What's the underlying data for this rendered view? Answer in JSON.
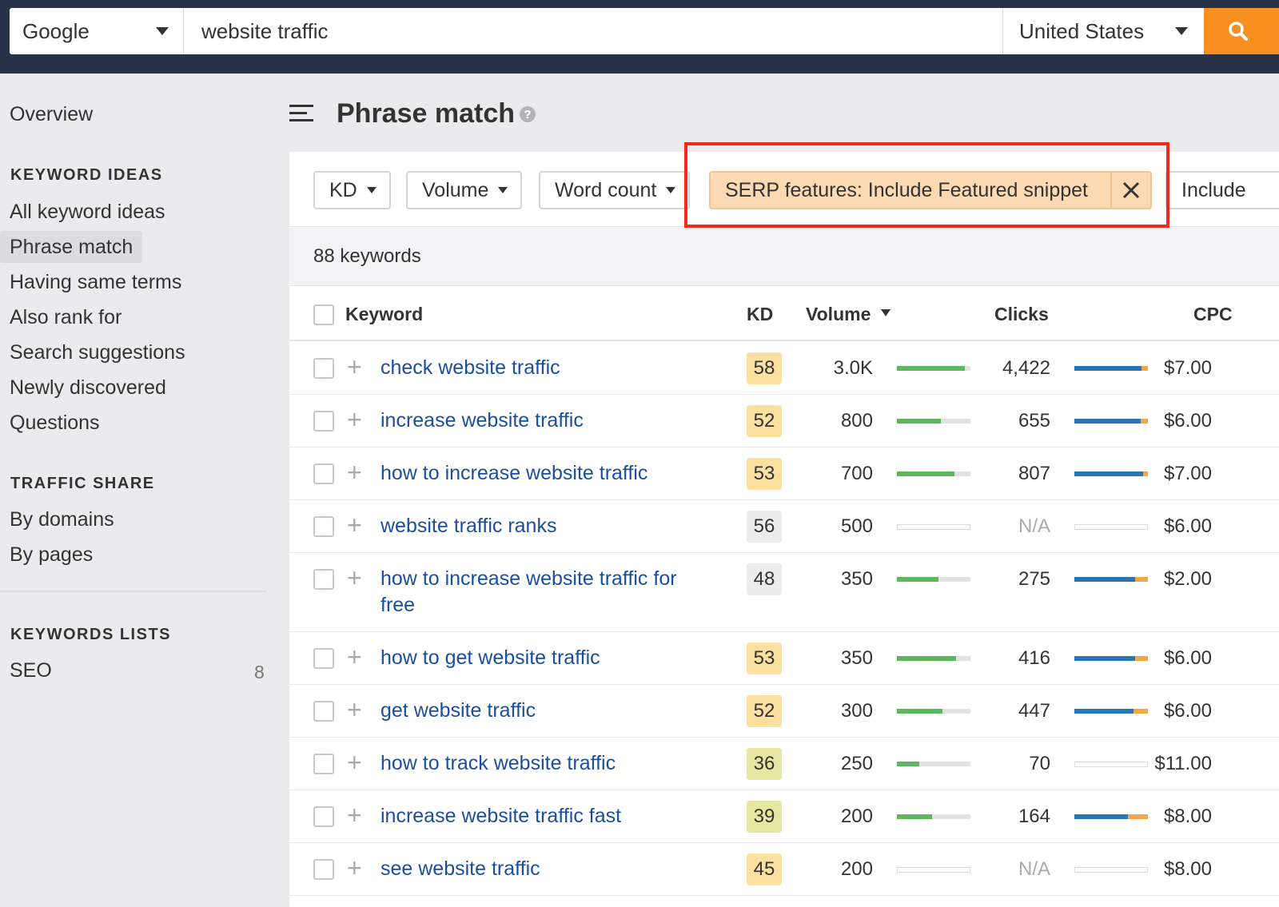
{
  "search": {
    "engine": "Google",
    "query": "website traffic",
    "country": "United States"
  },
  "sidebar": {
    "overview": "Overview",
    "keyword_ideas_heading": "KEYWORD IDEAS",
    "keyword_ideas": [
      "All keyword ideas",
      "Phrase match",
      "Having same terms",
      "Also rank for",
      "Search suggestions",
      "Newly discovered",
      "Questions"
    ],
    "active_item": "Phrase match",
    "traffic_share_heading": "TRAFFIC SHARE",
    "traffic_share": [
      "By domains",
      "By pages"
    ],
    "keywords_lists_heading": "KEYWORDS LISTS",
    "lists": [
      {
        "name": "SEO",
        "count": "8"
      }
    ]
  },
  "header": {
    "title": "Phrase match",
    "help": "?"
  },
  "filters": {
    "kd": "KD",
    "volume": "Volume",
    "word_count": "Word count",
    "serp": "SERP features: Include Featured snippet",
    "include": "Include"
  },
  "count_label": "88 keywords",
  "table": {
    "columns": {
      "keyword": "Keyword",
      "kd": "KD",
      "volume": "Volume",
      "clicks": "Clicks",
      "cpc": "CPC"
    },
    "rows": [
      {
        "keyword": "check website traffic",
        "kd": "58",
        "kd_color": "#fbe0a0",
        "volume": "3.0K",
        "volume_fill": 0.92,
        "clicks": "4,422",
        "clicks_blue": 0.91,
        "clicks_orange": 0.09,
        "cpc": "$7.00"
      },
      {
        "keyword": "increase website traffic",
        "kd": "52",
        "kd_color": "#fbe0a0",
        "volume": "800",
        "volume_fill": 0.6,
        "clicks": "655",
        "clicks_blue": 0.9,
        "clicks_orange": 0.1,
        "cpc": "$6.00"
      },
      {
        "keyword": "how to increase website traffic",
        "kd": "53",
        "kd_color": "#fbe0a0",
        "volume": "700",
        "volume_fill": 0.78,
        "clicks": "807",
        "clicks_blue": 0.93,
        "clicks_orange": 0.07,
        "cpc": "$7.00"
      },
      {
        "keyword": "website traffic ranks",
        "kd": "56",
        "kd_color": "#ececec",
        "volume": "500",
        "volume_fill": 0,
        "clicks": "N/A",
        "clicks_blue": 0,
        "clicks_orange": 0,
        "cpc": "$6.00"
      },
      {
        "keyword": "how to increase website traffic for free",
        "kd": "48",
        "kd_color": "#ececec",
        "volume": "350",
        "volume_fill": 0.56,
        "clicks": "275",
        "clicks_blue": 0.83,
        "clicks_orange": 0.17,
        "cpc": "$2.00"
      },
      {
        "keyword": "how to get website traffic",
        "kd": "53",
        "kd_color": "#fbe0a0",
        "volume": "350",
        "volume_fill": 0.8,
        "clicks": "416",
        "clicks_blue": 0.83,
        "clicks_orange": 0.17,
        "cpc": "$6.00"
      },
      {
        "keyword": "get website traffic",
        "kd": "52",
        "kd_color": "#fbe0a0",
        "volume": "300",
        "volume_fill": 0.62,
        "clicks": "447",
        "clicks_blue": 0.8,
        "clicks_orange": 0.2,
        "cpc": "$6.00"
      },
      {
        "keyword": "how to track website traffic",
        "kd": "36",
        "kd_color": "#e6e6a0",
        "volume": "250",
        "volume_fill": 0.3,
        "clicks": "70",
        "clicks_blue": 0,
        "clicks_orange": 0,
        "cpc": "$11.00"
      },
      {
        "keyword": "increase website traffic fast",
        "kd": "39",
        "kd_color": "#e6e6a0",
        "volume": "200",
        "volume_fill": 0.48,
        "clicks": "164",
        "clicks_blue": 0.73,
        "clicks_orange": 0.27,
        "cpc": "$8.00"
      },
      {
        "keyword": "see website traffic",
        "kd": "45",
        "kd_color": "#fbe0a0",
        "volume": "200",
        "volume_fill": 0,
        "clicks": "N/A",
        "clicks_blue": 0,
        "clicks_orange": 0,
        "cpc": "$8.00"
      }
    ]
  },
  "colors": {
    "topbar": "#283347",
    "search_button": "#f7901e",
    "link": "#1a4fa0",
    "highlight": "#f32a1a",
    "volume_bar": "#5cb85c",
    "clicks_organic": "#2a74b8",
    "clicks_paid": "#f5a446"
  }
}
